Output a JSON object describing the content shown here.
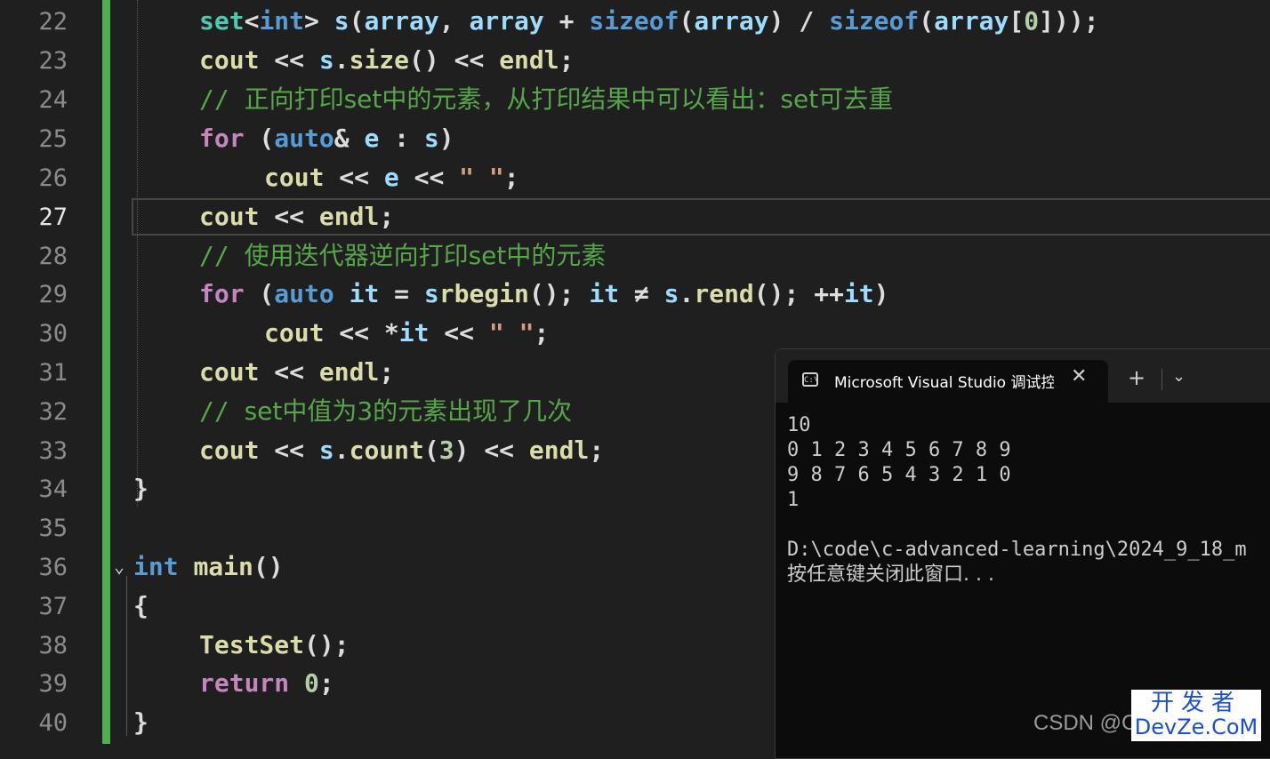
{
  "editor": {
    "line_numbers": [
      "22",
      "23",
      "24",
      "25",
      "26",
      "27",
      "28",
      "29",
      "30",
      "31",
      "32",
      "33",
      "34",
      "35",
      "36",
      "37",
      "38",
      "39",
      "40"
    ],
    "active_line": "27",
    "code": {
      "l22": {
        "a": "set",
        "b": "<",
        "c": "int",
        "d": "> ",
        "e": "s",
        "f": "(",
        "g": "array",
        ",": ", ",
        "h": "array",
        "i": " + ",
        "j": "sizeof",
        "k": "(",
        "l": "array",
        "m": ") / ",
        "n": "sizeof",
        "o": "(",
        "p": "array",
        "q": "[",
        "r": "0",
        "s": "]));"
      },
      "l23": {
        "a": "cout",
        "b": " << ",
        "c": "s",
        "d": ".",
        "e": "size",
        "f": "() << ",
        "g": "endl",
        "h": ";"
      },
      "l24": {
        "slash": "// ",
        "text": "正向打印set中的元素，从打印结果中可以看出：set可去重"
      },
      "l25": {
        "a": "for",
        "b": " (",
        "c": "auto",
        "d": "& ",
        "e": "e",
        "f": " : ",
        "g": "s",
        "h": ")"
      },
      "l26": {
        "a": "cout",
        "b": " << ",
        "c": "e",
        "d": " << ",
        "e": "\" \"",
        ";": ";"
      },
      "l27": {
        "a": "cout",
        "b": " << ",
        "c": "endl",
        "d": ";"
      },
      "l28": {
        "slash": "// ",
        "text": "使用迭代器逆向打印set中的元素"
      },
      "l29": {
        "a": "for",
        "b": " (",
        "c": "auto",
        "d": " ",
        "e": "it",
        "f": " = ",
        "g": "s",
        ".": ".",
        "h": "rbegin",
        "i": "(); ",
        "j": "it",
        "k": " ≠ ",
        "l": "s",
        "m": ".",
        "n": "rend",
        "o": "(); ++",
        "p": "it",
        "q": ")"
      },
      "l30": {
        "a": "cout",
        "b": " << *",
        "c": "it",
        "d": " << ",
        "e": "\" \"",
        ";": ";"
      },
      "l31": {
        "a": "cout",
        "b": " << ",
        "c": "endl",
        "d": ";"
      },
      "l32": {
        "slash": "// ",
        "text": "set中值为3的元素出现了几次"
      },
      "l33": {
        "a": "cout",
        "b": " << ",
        "c": "s",
        "d": ".",
        "e": "count",
        "f": "(",
        "g": "3",
        "h": ") << ",
        "i": "endl",
        "j": ";"
      },
      "l34": {
        "a": "}"
      },
      "l36": {
        "a": "int",
        "b": " ",
        "c": "main",
        "d": "()"
      },
      "l37": {
        "a": "{"
      },
      "l38": {
        "a": "TestSet",
        "b": "();"
      },
      "l39": {
        "a": "return",
        "b": " ",
        "c": "0",
        "d": ";"
      },
      "l40": {
        "a": "}"
      }
    }
  },
  "console": {
    "tab_title": "Microsoft Visual Studio 调试控制台",
    "close_glyph": "✕",
    "new_tab_glyph": "+",
    "dropdown_glyph": "⌄",
    "output": [
      "10",
      "0 1 2 3 4 5 6 7 8 9",
      "9 8 7 6 5 4 3 2 1 0",
      "1",
      "",
      "D:\\code\\c-advanced-learning\\2024_9_18_m",
      "按任意键关闭此窗口. . ."
    ]
  },
  "watermark": {
    "csdn": "CSDN @C",
    "top": "开发者",
    "bottom": "DevZe.CoM"
  },
  "colors": {
    "background": "#1f1f1f",
    "change_bar": "#4fb14e",
    "comment": "#57a64a",
    "keyword": "#c586c0",
    "type": "#569cd6"
  }
}
